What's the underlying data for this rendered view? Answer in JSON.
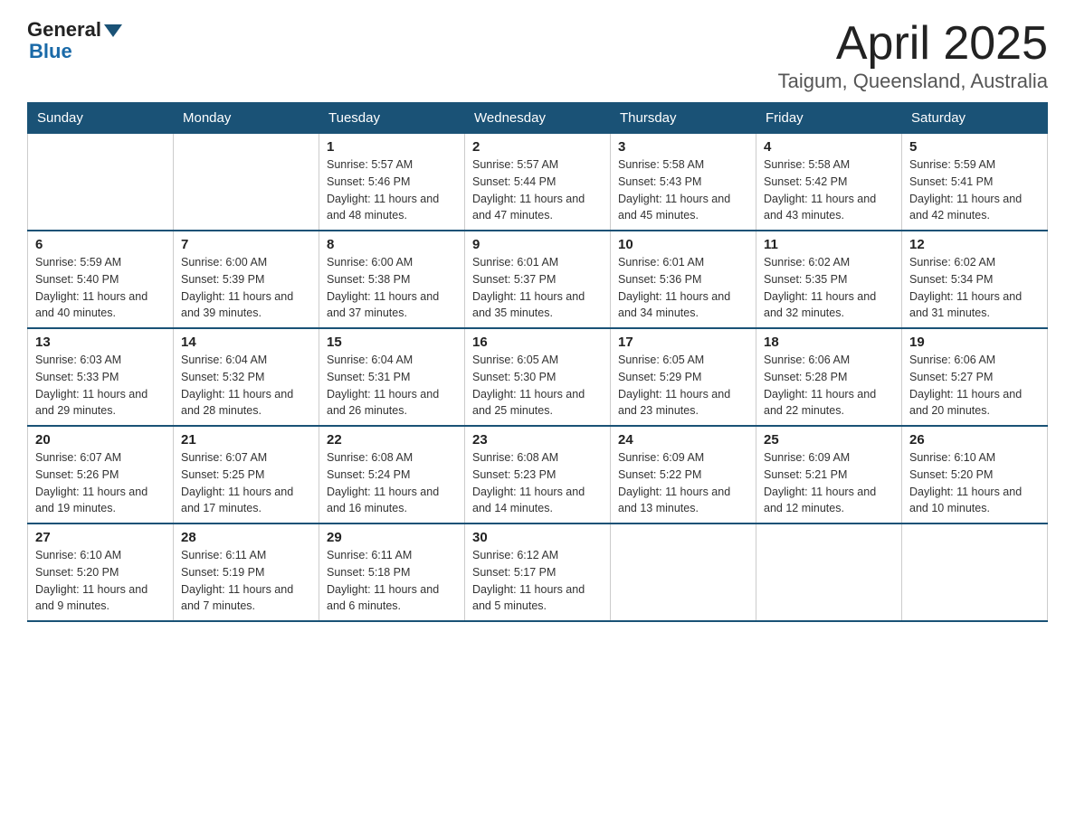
{
  "header": {
    "logo_general": "General",
    "logo_blue": "Blue",
    "title": "April 2025",
    "subtitle": "Taigum, Queensland, Australia"
  },
  "days_of_week": [
    "Sunday",
    "Monday",
    "Tuesday",
    "Wednesday",
    "Thursday",
    "Friday",
    "Saturday"
  ],
  "weeks": [
    [
      {
        "num": "",
        "sunrise": "",
        "sunset": "",
        "daylight": ""
      },
      {
        "num": "",
        "sunrise": "",
        "sunset": "",
        "daylight": ""
      },
      {
        "num": "1",
        "sunrise": "Sunrise: 5:57 AM",
        "sunset": "Sunset: 5:46 PM",
        "daylight": "Daylight: 11 hours and 48 minutes."
      },
      {
        "num": "2",
        "sunrise": "Sunrise: 5:57 AM",
        "sunset": "Sunset: 5:44 PM",
        "daylight": "Daylight: 11 hours and 47 minutes."
      },
      {
        "num": "3",
        "sunrise": "Sunrise: 5:58 AM",
        "sunset": "Sunset: 5:43 PM",
        "daylight": "Daylight: 11 hours and 45 minutes."
      },
      {
        "num": "4",
        "sunrise": "Sunrise: 5:58 AM",
        "sunset": "Sunset: 5:42 PM",
        "daylight": "Daylight: 11 hours and 43 minutes."
      },
      {
        "num": "5",
        "sunrise": "Sunrise: 5:59 AM",
        "sunset": "Sunset: 5:41 PM",
        "daylight": "Daylight: 11 hours and 42 minutes."
      }
    ],
    [
      {
        "num": "6",
        "sunrise": "Sunrise: 5:59 AM",
        "sunset": "Sunset: 5:40 PM",
        "daylight": "Daylight: 11 hours and 40 minutes."
      },
      {
        "num": "7",
        "sunrise": "Sunrise: 6:00 AM",
        "sunset": "Sunset: 5:39 PM",
        "daylight": "Daylight: 11 hours and 39 minutes."
      },
      {
        "num": "8",
        "sunrise": "Sunrise: 6:00 AM",
        "sunset": "Sunset: 5:38 PM",
        "daylight": "Daylight: 11 hours and 37 minutes."
      },
      {
        "num": "9",
        "sunrise": "Sunrise: 6:01 AM",
        "sunset": "Sunset: 5:37 PM",
        "daylight": "Daylight: 11 hours and 35 minutes."
      },
      {
        "num": "10",
        "sunrise": "Sunrise: 6:01 AM",
        "sunset": "Sunset: 5:36 PM",
        "daylight": "Daylight: 11 hours and 34 minutes."
      },
      {
        "num": "11",
        "sunrise": "Sunrise: 6:02 AM",
        "sunset": "Sunset: 5:35 PM",
        "daylight": "Daylight: 11 hours and 32 minutes."
      },
      {
        "num": "12",
        "sunrise": "Sunrise: 6:02 AM",
        "sunset": "Sunset: 5:34 PM",
        "daylight": "Daylight: 11 hours and 31 minutes."
      }
    ],
    [
      {
        "num": "13",
        "sunrise": "Sunrise: 6:03 AM",
        "sunset": "Sunset: 5:33 PM",
        "daylight": "Daylight: 11 hours and 29 minutes."
      },
      {
        "num": "14",
        "sunrise": "Sunrise: 6:04 AM",
        "sunset": "Sunset: 5:32 PM",
        "daylight": "Daylight: 11 hours and 28 minutes."
      },
      {
        "num": "15",
        "sunrise": "Sunrise: 6:04 AM",
        "sunset": "Sunset: 5:31 PM",
        "daylight": "Daylight: 11 hours and 26 minutes."
      },
      {
        "num": "16",
        "sunrise": "Sunrise: 6:05 AM",
        "sunset": "Sunset: 5:30 PM",
        "daylight": "Daylight: 11 hours and 25 minutes."
      },
      {
        "num": "17",
        "sunrise": "Sunrise: 6:05 AM",
        "sunset": "Sunset: 5:29 PM",
        "daylight": "Daylight: 11 hours and 23 minutes."
      },
      {
        "num": "18",
        "sunrise": "Sunrise: 6:06 AM",
        "sunset": "Sunset: 5:28 PM",
        "daylight": "Daylight: 11 hours and 22 minutes."
      },
      {
        "num": "19",
        "sunrise": "Sunrise: 6:06 AM",
        "sunset": "Sunset: 5:27 PM",
        "daylight": "Daylight: 11 hours and 20 minutes."
      }
    ],
    [
      {
        "num": "20",
        "sunrise": "Sunrise: 6:07 AM",
        "sunset": "Sunset: 5:26 PM",
        "daylight": "Daylight: 11 hours and 19 minutes."
      },
      {
        "num": "21",
        "sunrise": "Sunrise: 6:07 AM",
        "sunset": "Sunset: 5:25 PM",
        "daylight": "Daylight: 11 hours and 17 minutes."
      },
      {
        "num": "22",
        "sunrise": "Sunrise: 6:08 AM",
        "sunset": "Sunset: 5:24 PM",
        "daylight": "Daylight: 11 hours and 16 minutes."
      },
      {
        "num": "23",
        "sunrise": "Sunrise: 6:08 AM",
        "sunset": "Sunset: 5:23 PM",
        "daylight": "Daylight: 11 hours and 14 minutes."
      },
      {
        "num": "24",
        "sunrise": "Sunrise: 6:09 AM",
        "sunset": "Sunset: 5:22 PM",
        "daylight": "Daylight: 11 hours and 13 minutes."
      },
      {
        "num": "25",
        "sunrise": "Sunrise: 6:09 AM",
        "sunset": "Sunset: 5:21 PM",
        "daylight": "Daylight: 11 hours and 12 minutes."
      },
      {
        "num": "26",
        "sunrise": "Sunrise: 6:10 AM",
        "sunset": "Sunset: 5:20 PM",
        "daylight": "Daylight: 11 hours and 10 minutes."
      }
    ],
    [
      {
        "num": "27",
        "sunrise": "Sunrise: 6:10 AM",
        "sunset": "Sunset: 5:20 PM",
        "daylight": "Daylight: 11 hours and 9 minutes."
      },
      {
        "num": "28",
        "sunrise": "Sunrise: 6:11 AM",
        "sunset": "Sunset: 5:19 PM",
        "daylight": "Daylight: 11 hours and 7 minutes."
      },
      {
        "num": "29",
        "sunrise": "Sunrise: 6:11 AM",
        "sunset": "Sunset: 5:18 PM",
        "daylight": "Daylight: 11 hours and 6 minutes."
      },
      {
        "num": "30",
        "sunrise": "Sunrise: 6:12 AM",
        "sunset": "Sunset: 5:17 PM",
        "daylight": "Daylight: 11 hours and 5 minutes."
      },
      {
        "num": "",
        "sunrise": "",
        "sunset": "",
        "daylight": ""
      },
      {
        "num": "",
        "sunrise": "",
        "sunset": "",
        "daylight": ""
      },
      {
        "num": "",
        "sunrise": "",
        "sunset": "",
        "daylight": ""
      }
    ]
  ]
}
